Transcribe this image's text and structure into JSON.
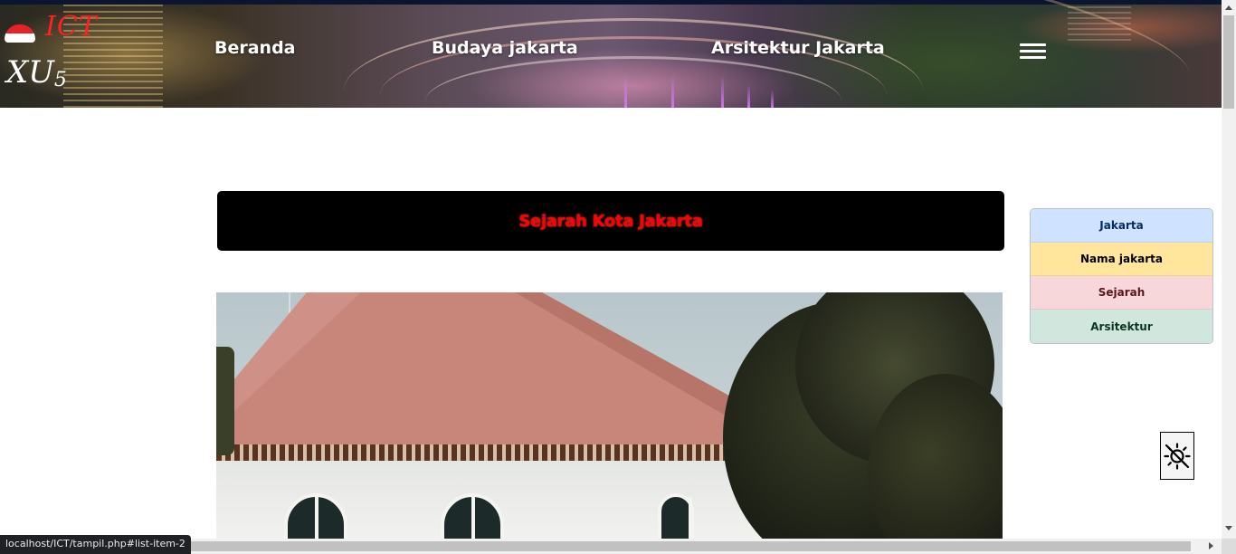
{
  "header": {
    "logo_top": "ICT",
    "logo_bottom": "XU",
    "logo_sub": "5",
    "nav": [
      {
        "label": "Beranda"
      },
      {
        "label": "Budaya jakarta"
      },
      {
        "label": "Arsitektur Jakarta"
      }
    ],
    "menu_icon": "hamburger-icon"
  },
  "main": {
    "title": "Sejarah Kota Jakarta",
    "image_alt_icon": "photo"
  },
  "sidebar": {
    "items": [
      {
        "label": "Jakarta",
        "color": "#cfe2ff"
      },
      {
        "label": "Nama jakarta",
        "color": "#ffe69c"
      },
      {
        "label": "Sejarah",
        "color": "#f8d7da"
      },
      {
        "label": "Arsitektur",
        "color": "#d1e7dd"
      }
    ]
  },
  "theme_toggle": {
    "icon": "sun-off-icon"
  },
  "status_bar": {
    "url": "localhost/ICT/tampil.php#list-item-2"
  },
  "colors": {
    "title_bg": "#000000",
    "title_text": "#ff0000",
    "logo_red": "#ff2020"
  }
}
